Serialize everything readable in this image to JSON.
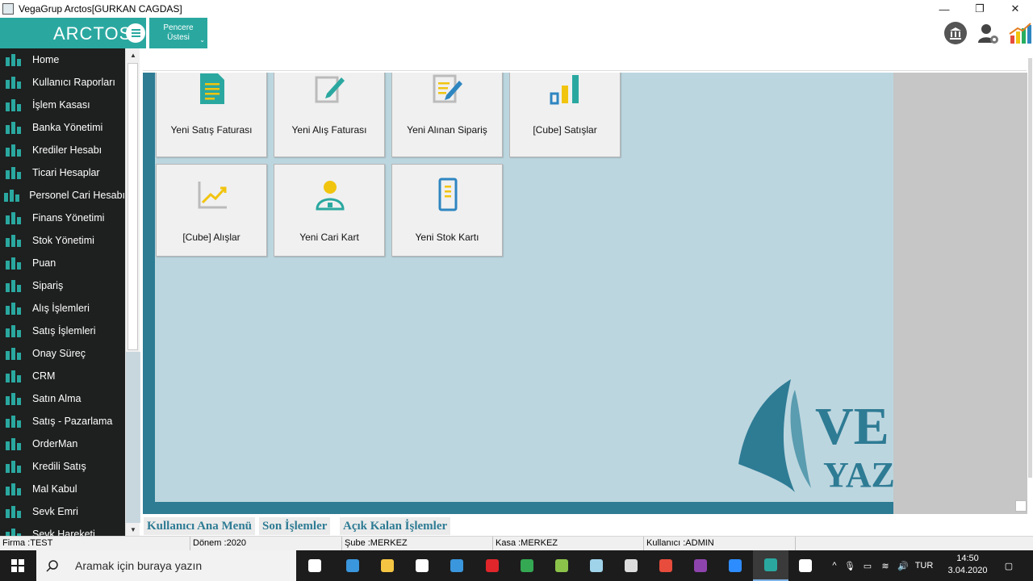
{
  "window": {
    "title": "VegaGrup Arctos[GURKAN CAGDAS]",
    "minimize": "—",
    "restore": "❐",
    "close": "✕"
  },
  "header": {
    "logo": "ARCTOS",
    "pencere_line1": "Pencere",
    "pencere_line2": "Üstesi",
    "icons": [
      "bank-icon",
      "user-settings-icon",
      "chart-icon"
    ]
  },
  "sidebar": {
    "items": [
      {
        "label": "Home",
        "icon": "home-icon"
      },
      {
        "label": "Kullanıcı Raporları",
        "icon": "report-icon"
      },
      {
        "label": "İşlem Kasası",
        "icon": "cashbox-icon"
      },
      {
        "label": "Banka Yönetimi",
        "icon": "bank-chart-icon"
      },
      {
        "label": "Krediler Hesabı",
        "icon": "credit-card-icon"
      },
      {
        "label": "Ticari Hesaplar",
        "icon": "person-icon"
      },
      {
        "label": "Personel Cari Hesabı",
        "icon": "people-icon"
      },
      {
        "label": "Finans Yönetimi",
        "icon": "finance-icon"
      },
      {
        "label": "Stok Yönetimi",
        "icon": "stock-icon"
      },
      {
        "label": "Puan",
        "icon": "points-icon"
      },
      {
        "label": "Sipariş",
        "icon": "cart-icon"
      },
      {
        "label": "Alış İşlemleri",
        "icon": "purchase-icon"
      },
      {
        "label": "Satış İşlemleri",
        "icon": "sales-icon"
      },
      {
        "label": "Onay Süreç",
        "icon": "approval-icon"
      },
      {
        "label": "CRM",
        "icon": "crm-icon"
      },
      {
        "label": "Satın Alma",
        "icon": "buy-icon"
      },
      {
        "label": "Satış - Pazarlama",
        "icon": "marketing-icon"
      },
      {
        "label": "OrderMan",
        "icon": "orderman-icon"
      },
      {
        "label": "Kredili Satış",
        "icon": "credit-sale-icon"
      },
      {
        "label": "Mal Kabul",
        "icon": "goods-receipt-icon"
      },
      {
        "label": "Sevk Emri",
        "icon": "dispatch-icon"
      },
      {
        "label": "Sevk Hareketi",
        "icon": "dispatch-move-icon"
      }
    ]
  },
  "tiles": [
    {
      "label": "Yeni Satış Faturası",
      "icon": "sales-invoice-icon"
    },
    {
      "label": "Yeni Alış Faturası",
      "icon": "purchase-invoice-icon"
    },
    {
      "label": "Yeni Alınan Sipariş",
      "icon": "received-order-icon"
    },
    {
      "label": "[Cube] Satışlar",
      "icon": "bar-chart-icon"
    },
    {
      "label": "[Cube] Alışlar",
      "icon": "line-chart-icon"
    },
    {
      "label": "Yeni Cari Kart",
      "icon": "customer-card-icon"
    },
    {
      "label": "Yeni Stok Kartı",
      "icon": "stock-card-icon"
    }
  ],
  "watermark": {
    "line1": "VE",
    "line2": "YAZ"
  },
  "tabs": [
    "Kullanıcı Ana Menü",
    "Son İşlemler",
    "Açık Kalan İşlemler"
  ],
  "status": {
    "firma": "Firma :TEST",
    "donem": "Dönem :2020",
    "sube": "Şube :MERKEZ",
    "kasa": "Kasa :MERKEZ",
    "kullanici": "Kullanıcı :ADMIN"
  },
  "taskbar": {
    "search_placeholder": "Aramak için buraya yazın",
    "lang": "TUR",
    "time": "14:50",
    "date": "3.04.2020",
    "apps": [
      "task-view-icon",
      "edge-icon",
      "file-explorer-icon",
      "store-icon",
      "mail-icon",
      "opera-icon",
      "chrome-icon",
      "notepad-plus-icon",
      "app-icon",
      "tool-icon",
      "photo-app-icon",
      "visual-studio-icon",
      "zoom-icon",
      "arctos-icon",
      "document-icon"
    ]
  },
  "colors": {
    "accent": "#2aa8a0",
    "sidebar_bg": "#1e1f1f",
    "main_frame": "#2e7b94",
    "main_bg": "#bcd6df",
    "tab_text": "#2e7b94"
  }
}
